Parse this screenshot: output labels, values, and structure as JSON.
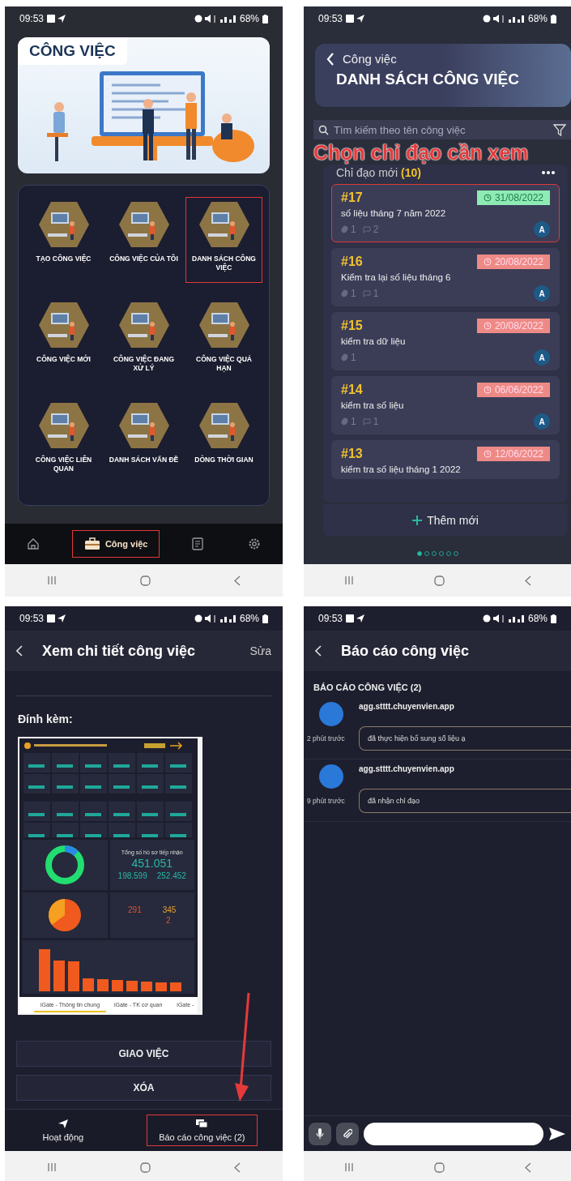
{
  "screens": [
    {
      "kind": "menu",
      "status": {
        "time": "09:53",
        "battery": "68%"
      },
      "banner_title": "CÔNG VIỆC",
      "tiles": [
        {
          "label": "TẠO CÔNG VIỆC",
          "highlighted": false
        },
        {
          "label": "CÔNG VIỆC CỦA TÔI",
          "highlighted": false
        },
        {
          "label": "DANH SÁCH CÔNG VIỆC",
          "highlighted": true
        },
        {
          "label": "CÔNG VIỆC MỚI",
          "highlighted": false
        },
        {
          "label": "CÔNG VIỆC ĐANG XỬ LÝ",
          "highlighted": false
        },
        {
          "label": "CÔNG VIỆC QUÁ HẠN",
          "highlighted": false
        },
        {
          "label": "CÔNG VIỆC LIÊN QUAN",
          "highlighted": false
        },
        {
          "label": "DANH SÁCH VẤN ĐỀ",
          "highlighted": false
        },
        {
          "label": "DÒNG THỜI GIAN",
          "highlighted": false
        }
      ],
      "nav": [
        {
          "kind": "home",
          "selected": false,
          "highlighted": false
        },
        {
          "kind": "work",
          "label": "Công việc",
          "selected": true,
          "highlighted": true
        },
        {
          "kind": "document",
          "selected": false,
          "highlighted": false
        },
        {
          "kind": "settings",
          "selected": false,
          "highlighted": false
        }
      ]
    },
    {
      "kind": "list",
      "status": {
        "time": "09:53",
        "battery": "68%"
      },
      "back_label": "Công việc",
      "title": "DANH SÁCH CÔNG VIỆC",
      "search": {
        "placeholder": "Tìm kiếm theo tên công việc"
      },
      "annotation": "Chọn chỉ đạo cần xem",
      "section": "Chỉ đạo mới",
      "count": "(10)",
      "cards": [
        {
          "number": "#17",
          "date": "31/08/2022",
          "overdue": false,
          "title": "số liệu tháng 7 năm 2022",
          "attachments": "1",
          "comments": "2",
          "assignee": "A",
          "highlighted": true
        },
        {
          "number": "#16",
          "date": "20/08/2022",
          "overdue": true,
          "title": "Kiểm tra lại số liệu tháng 6",
          "attachments": "1",
          "comments": "1",
          "assignee": "A",
          "highlighted": false
        },
        {
          "number": "#15",
          "date": "20/08/2022",
          "overdue": true,
          "title": "kiểm tra dữ liệu",
          "attachments": "1",
          "assignee": "A",
          "highlighted": false
        },
        {
          "number": "#14",
          "date": "06/06/2022",
          "overdue": true,
          "title": "kiểm tra số liệu",
          "attachments": "1",
          "comments": "1",
          "assignee": "A",
          "highlighted": false
        },
        {
          "number": "#13",
          "date": "12/06/2022",
          "overdue": true,
          "title": "kiểm tra số liệu tháng 1 2022",
          "highlighted": false
        }
      ],
      "add_button": "Thêm mới",
      "pages": [
        {
          "selected": true
        },
        {
          "selected": false
        },
        {
          "selected": false
        },
        {
          "selected": false
        },
        {
          "selected": false
        },
        {
          "selected": false
        }
      ]
    },
    {
      "kind": "detail",
      "status": {
        "time": "09:53",
        "battery": "68%"
      },
      "title": "Xem chi tiết công việc",
      "action": "Sửa",
      "attachments_label": "Đính kèm:",
      "attachment": {
        "total_label": "Tổng số hồ sơ tiếp nhận",
        "total": "451.051",
        "online": "198.599",
        "direct": "252.452",
        "stats": [
          "291",
          "345",
          "2"
        ],
        "tabs": [
          {
            "label": "iGate - Thông tin chung",
            "selected": true
          },
          {
            "label": "iGate - TK cơ quan",
            "selected": false
          },
          {
            "label": "iGate -",
            "selected": false
          }
        ]
      },
      "buttons": [
        "GIAO VIỆC",
        "XÓA"
      ],
      "tabs": [
        {
          "kind": "send",
          "label": "Hoạt động",
          "highlighted": false
        },
        {
          "kind": "chat",
          "label": "Báo cáo công việc (2)",
          "highlighted": true
        }
      ]
    },
    {
      "kind": "chat",
      "status": {
        "time": "09:53",
        "battery": "68%"
      },
      "title": "Báo cáo công việc",
      "section": "BÁO CÁO CÔNG VIỆC (2)",
      "messages": [
        {
          "author": "agg.stttt.chuyenvien.app",
          "time": "2 phút trước",
          "text": "đã thực hiện bổ sung số liệu ạ"
        },
        {
          "author": "agg.stttt.chuyenvien.app",
          "time": "9 phút trước",
          "text": "đã nhận chỉ đạo"
        }
      ]
    }
  ]
}
